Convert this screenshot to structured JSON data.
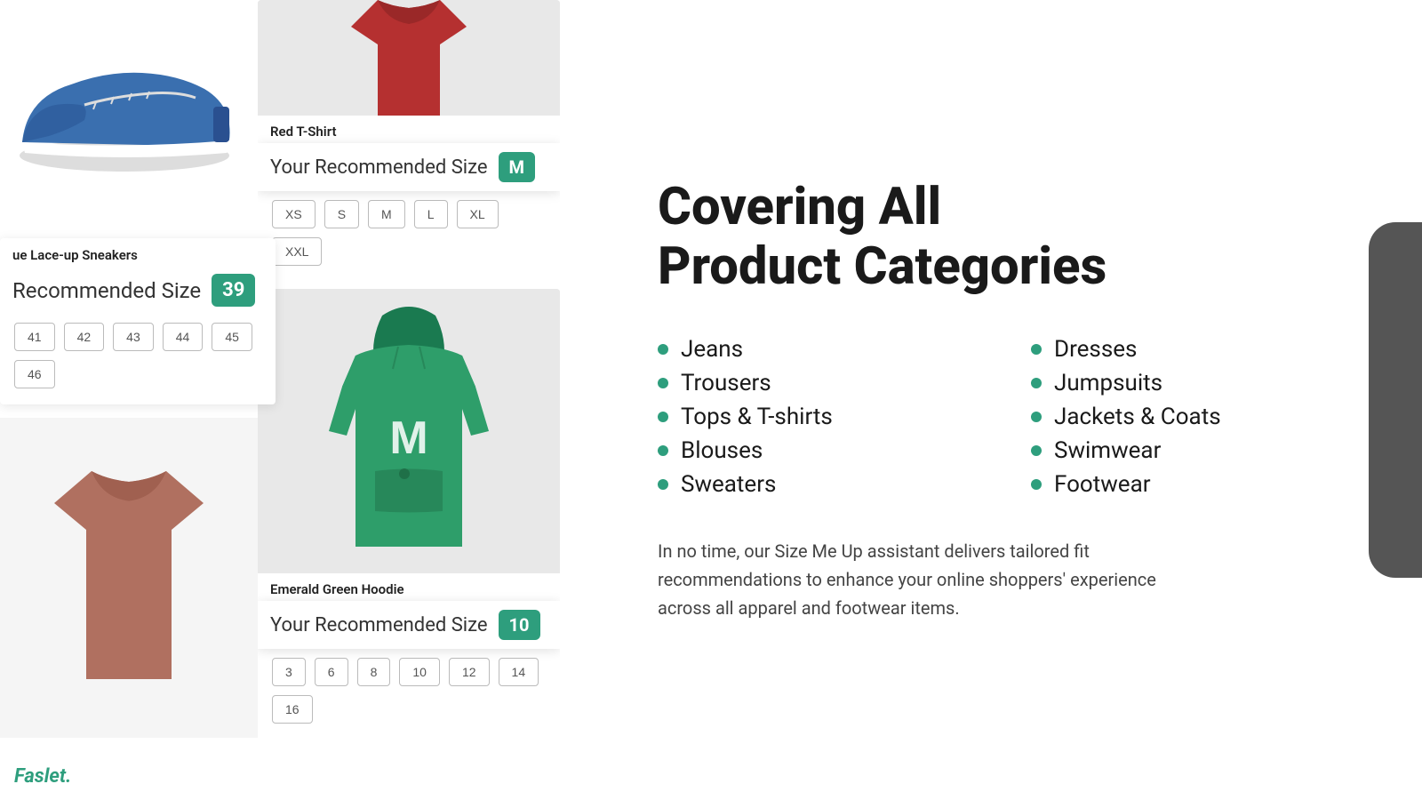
{
  "left": {
    "sneaker_title": "ue Lace-up Sneakers",
    "sneaker_size_label": "Recommended Size",
    "sneaker_size_value": "39",
    "sneaker_sizes": [
      "41",
      "42",
      "43",
      "44",
      "45",
      "46"
    ],
    "tshirt_title": "Red T-Shirt",
    "tshirt_recommended_label": "Your Recommended Size",
    "tshirt_size_value": "M",
    "tshirt_sizes": [
      "XS",
      "S",
      "M",
      "L",
      "XL",
      "XXL"
    ],
    "hoodie_title": "Emerald Green Hoodie",
    "hoodie_recommended_label": "Your Recommended Size",
    "hoodie_size_value": "10",
    "hoodie_sizes": [
      "3",
      "6",
      "8",
      "10",
      "12",
      "14",
      "16"
    ],
    "logo_text": "Faslet."
  },
  "right": {
    "heading_line1": "Covering All",
    "heading_line2": "Product Categories",
    "categories_left": [
      "Jeans",
      "Trousers",
      "Tops & T-shirts",
      "Blouses",
      "Sweaters"
    ],
    "categories_right": [
      "Dresses",
      "Jumpsuits",
      "Jackets & Coats",
      "Swimwear",
      "Footwear"
    ],
    "description": "In no time, our Size Me Up assistant delivers tailored fit recommendations to enhance your online shoppers' experience across all apparel and footwear items."
  }
}
